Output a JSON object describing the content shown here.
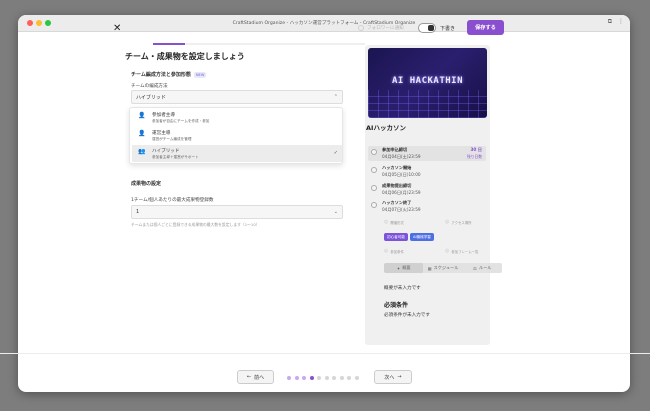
{
  "window": {
    "title": "CraftStadium Organize - ハッカソン運営プラットフォーム - CraftStadium Organize"
  },
  "toolbar": {
    "close_label": "✕",
    "follow_label": "フォロワーに通知",
    "draft_label": "下書き",
    "save_label": "保存する"
  },
  "form": {
    "title": "チーム・成果物を設定しましょう",
    "team_section": {
      "heading": "チーム編成方法と参加形態",
      "badge": "NEW",
      "label": "チームの編成方法",
      "selected": "ハイブリッド"
    },
    "dropdown": {
      "options": [
        {
          "name": "参加者主導",
          "desc": "参加者が自由にチームを作成・参加",
          "icon": "user-icon"
        },
        {
          "name": "運営主導",
          "desc": "運営がチーム編成を管理",
          "icon": "user-gear-icon"
        },
        {
          "name": "ハイブリッド",
          "desc": "参加者主導＋運営がサポート",
          "icon": "users-icon",
          "selected": true
        }
      ]
    },
    "deliverable_section": {
      "heading": "成果物の設定",
      "label": "1チーム/個人あたりの最大成果物登録数",
      "value": "1",
      "hint": "チームまたは個人ごとに登録できる成果物の最大数を設定します（1〜10）"
    }
  },
  "preview": {
    "banner_text": "AI HACKATHIN",
    "title": "AIハッカソン",
    "events": [
      {
        "name": "参加申込締切",
        "date": "04月04日(土)23:59",
        "countdown_num": "30 日",
        "countdown_label": "残り日数"
      },
      {
        "name": "ハッカソン開始",
        "date": "04月05日(日)10:00"
      },
      {
        "name": "成果物提出締切",
        "date": "04月06日(月)23:59"
      },
      {
        "name": "ハッカソン終了",
        "date": "04月07日(火)23:59"
      }
    ],
    "facts": [
      "開催形式",
      "アクセス場所",
      "参加条件",
      "参加フレーム一覧"
    ],
    "tags": [
      "初心者可能",
      "AI機械学習"
    ],
    "tabs": [
      {
        "icon": "star-icon",
        "label": "概要"
      },
      {
        "icon": "calendar-icon",
        "label": "スケジュール"
      },
      {
        "icon": "rule-icon",
        "label": "ルール"
      }
    ],
    "overview_text": "概要が未入力です",
    "requirements_heading": "必須条件",
    "requirements_text": "必須条件が未入力です"
  },
  "footer": {
    "prev_label": "前へ",
    "next_label": "次へ",
    "pages_total": 10,
    "current_page": 4
  },
  "colors": {
    "accent": "#8a4fce",
    "dot_done": "#c9a8ef",
    "dot_todo": "#d6d6d6"
  }
}
